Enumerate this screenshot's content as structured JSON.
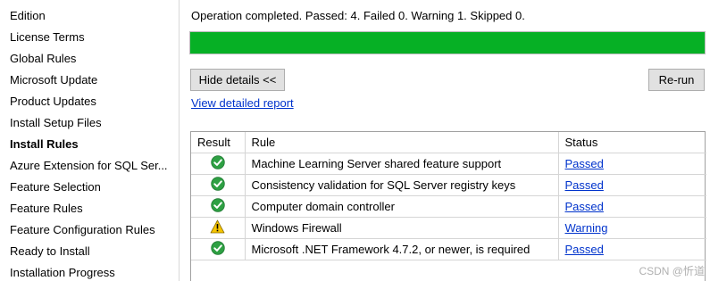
{
  "sidebar": {
    "items": [
      {
        "label": "Edition",
        "active": false
      },
      {
        "label": "License Terms",
        "active": false
      },
      {
        "label": "Global Rules",
        "active": false
      },
      {
        "label": "Microsoft Update",
        "active": false
      },
      {
        "label": "Product Updates",
        "active": false
      },
      {
        "label": "Install Setup Files",
        "active": false
      },
      {
        "label": "Install Rules",
        "active": true
      },
      {
        "label": "Azure Extension for SQL Ser...",
        "active": false
      },
      {
        "label": "Feature Selection",
        "active": false
      },
      {
        "label": "Feature Rules",
        "active": false
      },
      {
        "label": "Feature Configuration Rules",
        "active": false
      },
      {
        "label": "Ready to Install",
        "active": false
      },
      {
        "label": "Installation Progress",
        "active": false
      }
    ]
  },
  "summary": {
    "text": "Operation completed. Passed: 4.   Failed 0.   Warning 1.   Skipped 0."
  },
  "progress": {
    "percent": 100,
    "color": "#06b025"
  },
  "buttons": {
    "hide_details": "Hide details <<",
    "rerun": "Re-run"
  },
  "links": {
    "detailed_report": "View detailed report"
  },
  "table": {
    "headers": {
      "result": "Result",
      "rule": "Rule",
      "status": "Status"
    },
    "rows": [
      {
        "icon": "check-icon",
        "rule": "Machine Learning Server shared feature support",
        "status": "Passed"
      },
      {
        "icon": "check-icon",
        "rule": "Consistency validation for SQL Server registry keys",
        "status": "Passed"
      },
      {
        "icon": "check-icon",
        "rule": "Computer domain controller",
        "status": "Passed"
      },
      {
        "icon": "warning-icon",
        "rule": "Windows Firewall",
        "status": "Warning"
      },
      {
        "icon": "check-icon",
        "rule": "Microsoft .NET Framework 4.7.2, or newer, is required",
        "status": "Passed"
      }
    ]
  },
  "watermark": "CSDN @忻道",
  "colors": {
    "link": "#0033cc",
    "progress": "#06b025",
    "check": "#2ea043",
    "warning": "#f5c400"
  }
}
